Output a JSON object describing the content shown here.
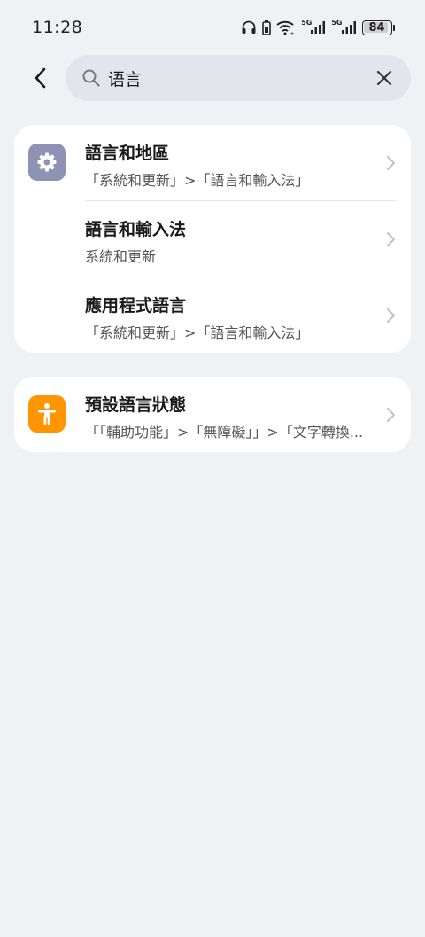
{
  "status_bar": {
    "time": "11:28",
    "network1": "5G",
    "network2": "5G",
    "battery": "84"
  },
  "search": {
    "value": "语言",
    "placeholder": ""
  },
  "results": {
    "group1": [
      {
        "title": "語言和地區",
        "subtitle": "「系統和更新」>「語言和輸入法」",
        "icon": "gear-icon",
        "icon_color": "#8e92b4"
      },
      {
        "title": "語言和輸入法",
        "subtitle": "系統和更新"
      },
      {
        "title": "應用程式語言",
        "subtitle": "「系統和更新」>「語言和輸入法」"
      }
    ],
    "group2": [
      {
        "title": "預設語言狀態",
        "subtitle": "「「輔助功能」>「無障礙」」>「文字轉換...",
        "icon": "accessibility-icon",
        "icon_color": "#ff9500"
      }
    ]
  }
}
